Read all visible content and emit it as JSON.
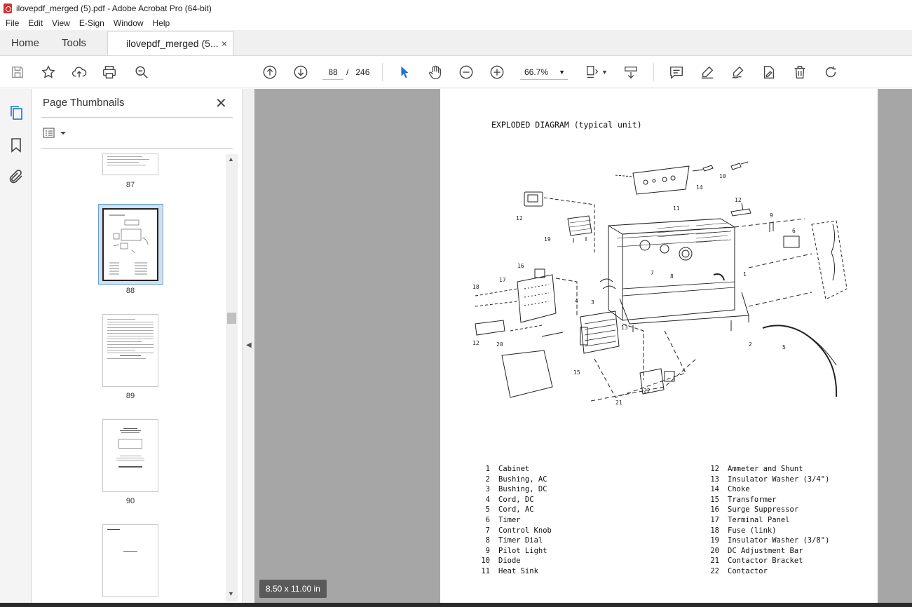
{
  "window": {
    "title": "ilovepdf_merged (5).pdf - Adobe Acrobat Pro (64-bit)"
  },
  "menu": [
    "File",
    "Edit",
    "View",
    "E-Sign",
    "Window",
    "Help"
  ],
  "tabs": {
    "home": "Home",
    "tools": "Tools",
    "document": "ilovepdf_merged (5...",
    "close": "×"
  },
  "toolbar": {
    "page_current": "88",
    "page_separator": "/",
    "page_total": "246",
    "zoom": "66.7%"
  },
  "panel": {
    "title": "Page Thumbnails",
    "close": "✕",
    "thumbnails": [
      {
        "label": "87"
      },
      {
        "label": "88",
        "selected": true
      },
      {
        "label": "89"
      },
      {
        "label": "90"
      },
      {
        "label": ""
      }
    ]
  },
  "document": {
    "heading": "EXPLODED DIAGRAM (typical unit)",
    "page_size": "8.50 x 11.00 in",
    "callouts": [
      "10",
      "11",
      "12",
      "14",
      "19",
      "12",
      "9",
      "6",
      "16",
      "17",
      "18",
      "4",
      "3",
      "7",
      "8",
      "1",
      "12",
      "20",
      "15",
      "13",
      "21",
      "22",
      "2",
      "5"
    ],
    "parts_left": [
      {
        "n": "1",
        "name": "Cabinet"
      },
      {
        "n": "2",
        "name": "Bushing, AC"
      },
      {
        "n": "3",
        "name": "Bushing, DC"
      },
      {
        "n": "4",
        "name": "Cord, DC"
      },
      {
        "n": "5",
        "name": "Cord, AC"
      },
      {
        "n": "6",
        "name": "Timer"
      },
      {
        "n": "7",
        "name": "Control Knob"
      },
      {
        "n": "8",
        "name": "Timer Dial"
      },
      {
        "n": "9",
        "name": "Pilot Light"
      },
      {
        "n": "10",
        "name": "Diode"
      },
      {
        "n": "11",
        "name": "Heat Sink"
      }
    ],
    "parts_right": [
      {
        "n": "12",
        "name": "Ammeter and Shunt"
      },
      {
        "n": "13",
        "name": "Insulator Washer (3/4\")"
      },
      {
        "n": "14",
        "name": "Choke"
      },
      {
        "n": "15",
        "name": "Transformer"
      },
      {
        "n": "16",
        "name": "Surge Suppressor"
      },
      {
        "n": "17",
        "name": "Terminal Panel"
      },
      {
        "n": "18",
        "name": "Fuse (link)"
      },
      {
        "n": "19",
        "name": "Insulator Washer (3/8\")"
      },
      {
        "n": "20",
        "name": "DC Adjustment Bar"
      },
      {
        "n": "21",
        "name": "Contactor Bracket"
      },
      {
        "n": "22",
        "name": "Contactor"
      }
    ]
  },
  "icons": {
    "app": "acrobat-pdf-icon",
    "save": "save-icon",
    "star": "bookmark-star-icon",
    "upload": "upload-cloud-icon",
    "print": "print-icon",
    "search": "search-icon",
    "prev": "previous-page-icon",
    "next": "next-page-icon",
    "select": "select-cursor-icon",
    "hand": "hand-tool-icon",
    "zoom_out": "zoom-out-icon",
    "zoom_in": "zoom-in-icon",
    "fit": "page-fit-icon",
    "scroll": "scroll-mode-icon",
    "comment": "comment-icon",
    "highlight": "highlight-icon",
    "sign": "sign-icon",
    "edit": "edit-pdf-icon",
    "delete": "delete-icon",
    "rotate": "rotate-icon"
  }
}
